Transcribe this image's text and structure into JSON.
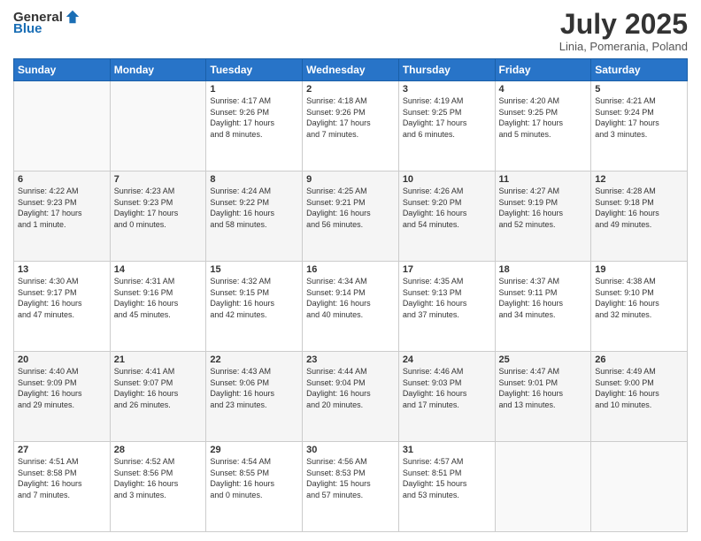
{
  "header": {
    "logo_general": "General",
    "logo_blue": "Blue",
    "title": "July 2025",
    "subtitle": "Linia, Pomerania, Poland"
  },
  "calendar": {
    "days_of_week": [
      "Sunday",
      "Monday",
      "Tuesday",
      "Wednesday",
      "Thursday",
      "Friday",
      "Saturday"
    ],
    "weeks": [
      [
        {
          "day": "",
          "info": ""
        },
        {
          "day": "",
          "info": ""
        },
        {
          "day": "1",
          "info": "Sunrise: 4:17 AM\nSunset: 9:26 PM\nDaylight: 17 hours\nand 8 minutes."
        },
        {
          "day": "2",
          "info": "Sunrise: 4:18 AM\nSunset: 9:26 PM\nDaylight: 17 hours\nand 7 minutes."
        },
        {
          "day": "3",
          "info": "Sunrise: 4:19 AM\nSunset: 9:25 PM\nDaylight: 17 hours\nand 6 minutes."
        },
        {
          "day": "4",
          "info": "Sunrise: 4:20 AM\nSunset: 9:25 PM\nDaylight: 17 hours\nand 5 minutes."
        },
        {
          "day": "5",
          "info": "Sunrise: 4:21 AM\nSunset: 9:24 PM\nDaylight: 17 hours\nand 3 minutes."
        }
      ],
      [
        {
          "day": "6",
          "info": "Sunrise: 4:22 AM\nSunset: 9:23 PM\nDaylight: 17 hours\nand 1 minute."
        },
        {
          "day": "7",
          "info": "Sunrise: 4:23 AM\nSunset: 9:23 PM\nDaylight: 17 hours\nand 0 minutes."
        },
        {
          "day": "8",
          "info": "Sunrise: 4:24 AM\nSunset: 9:22 PM\nDaylight: 16 hours\nand 58 minutes."
        },
        {
          "day": "9",
          "info": "Sunrise: 4:25 AM\nSunset: 9:21 PM\nDaylight: 16 hours\nand 56 minutes."
        },
        {
          "day": "10",
          "info": "Sunrise: 4:26 AM\nSunset: 9:20 PM\nDaylight: 16 hours\nand 54 minutes."
        },
        {
          "day": "11",
          "info": "Sunrise: 4:27 AM\nSunset: 9:19 PM\nDaylight: 16 hours\nand 52 minutes."
        },
        {
          "day": "12",
          "info": "Sunrise: 4:28 AM\nSunset: 9:18 PM\nDaylight: 16 hours\nand 49 minutes."
        }
      ],
      [
        {
          "day": "13",
          "info": "Sunrise: 4:30 AM\nSunset: 9:17 PM\nDaylight: 16 hours\nand 47 minutes."
        },
        {
          "day": "14",
          "info": "Sunrise: 4:31 AM\nSunset: 9:16 PM\nDaylight: 16 hours\nand 45 minutes."
        },
        {
          "day": "15",
          "info": "Sunrise: 4:32 AM\nSunset: 9:15 PM\nDaylight: 16 hours\nand 42 minutes."
        },
        {
          "day": "16",
          "info": "Sunrise: 4:34 AM\nSunset: 9:14 PM\nDaylight: 16 hours\nand 40 minutes."
        },
        {
          "day": "17",
          "info": "Sunrise: 4:35 AM\nSunset: 9:13 PM\nDaylight: 16 hours\nand 37 minutes."
        },
        {
          "day": "18",
          "info": "Sunrise: 4:37 AM\nSunset: 9:11 PM\nDaylight: 16 hours\nand 34 minutes."
        },
        {
          "day": "19",
          "info": "Sunrise: 4:38 AM\nSunset: 9:10 PM\nDaylight: 16 hours\nand 32 minutes."
        }
      ],
      [
        {
          "day": "20",
          "info": "Sunrise: 4:40 AM\nSunset: 9:09 PM\nDaylight: 16 hours\nand 29 minutes."
        },
        {
          "day": "21",
          "info": "Sunrise: 4:41 AM\nSunset: 9:07 PM\nDaylight: 16 hours\nand 26 minutes."
        },
        {
          "day": "22",
          "info": "Sunrise: 4:43 AM\nSunset: 9:06 PM\nDaylight: 16 hours\nand 23 minutes."
        },
        {
          "day": "23",
          "info": "Sunrise: 4:44 AM\nSunset: 9:04 PM\nDaylight: 16 hours\nand 20 minutes."
        },
        {
          "day": "24",
          "info": "Sunrise: 4:46 AM\nSunset: 9:03 PM\nDaylight: 16 hours\nand 17 minutes."
        },
        {
          "day": "25",
          "info": "Sunrise: 4:47 AM\nSunset: 9:01 PM\nDaylight: 16 hours\nand 13 minutes."
        },
        {
          "day": "26",
          "info": "Sunrise: 4:49 AM\nSunset: 9:00 PM\nDaylight: 16 hours\nand 10 minutes."
        }
      ],
      [
        {
          "day": "27",
          "info": "Sunrise: 4:51 AM\nSunset: 8:58 PM\nDaylight: 16 hours\nand 7 minutes."
        },
        {
          "day": "28",
          "info": "Sunrise: 4:52 AM\nSunset: 8:56 PM\nDaylight: 16 hours\nand 3 minutes."
        },
        {
          "day": "29",
          "info": "Sunrise: 4:54 AM\nSunset: 8:55 PM\nDaylight: 16 hours\nand 0 minutes."
        },
        {
          "day": "30",
          "info": "Sunrise: 4:56 AM\nSunset: 8:53 PM\nDaylight: 15 hours\nand 57 minutes."
        },
        {
          "day": "31",
          "info": "Sunrise: 4:57 AM\nSunset: 8:51 PM\nDaylight: 15 hours\nand 53 minutes."
        },
        {
          "day": "",
          "info": ""
        },
        {
          "day": "",
          "info": ""
        }
      ]
    ]
  }
}
